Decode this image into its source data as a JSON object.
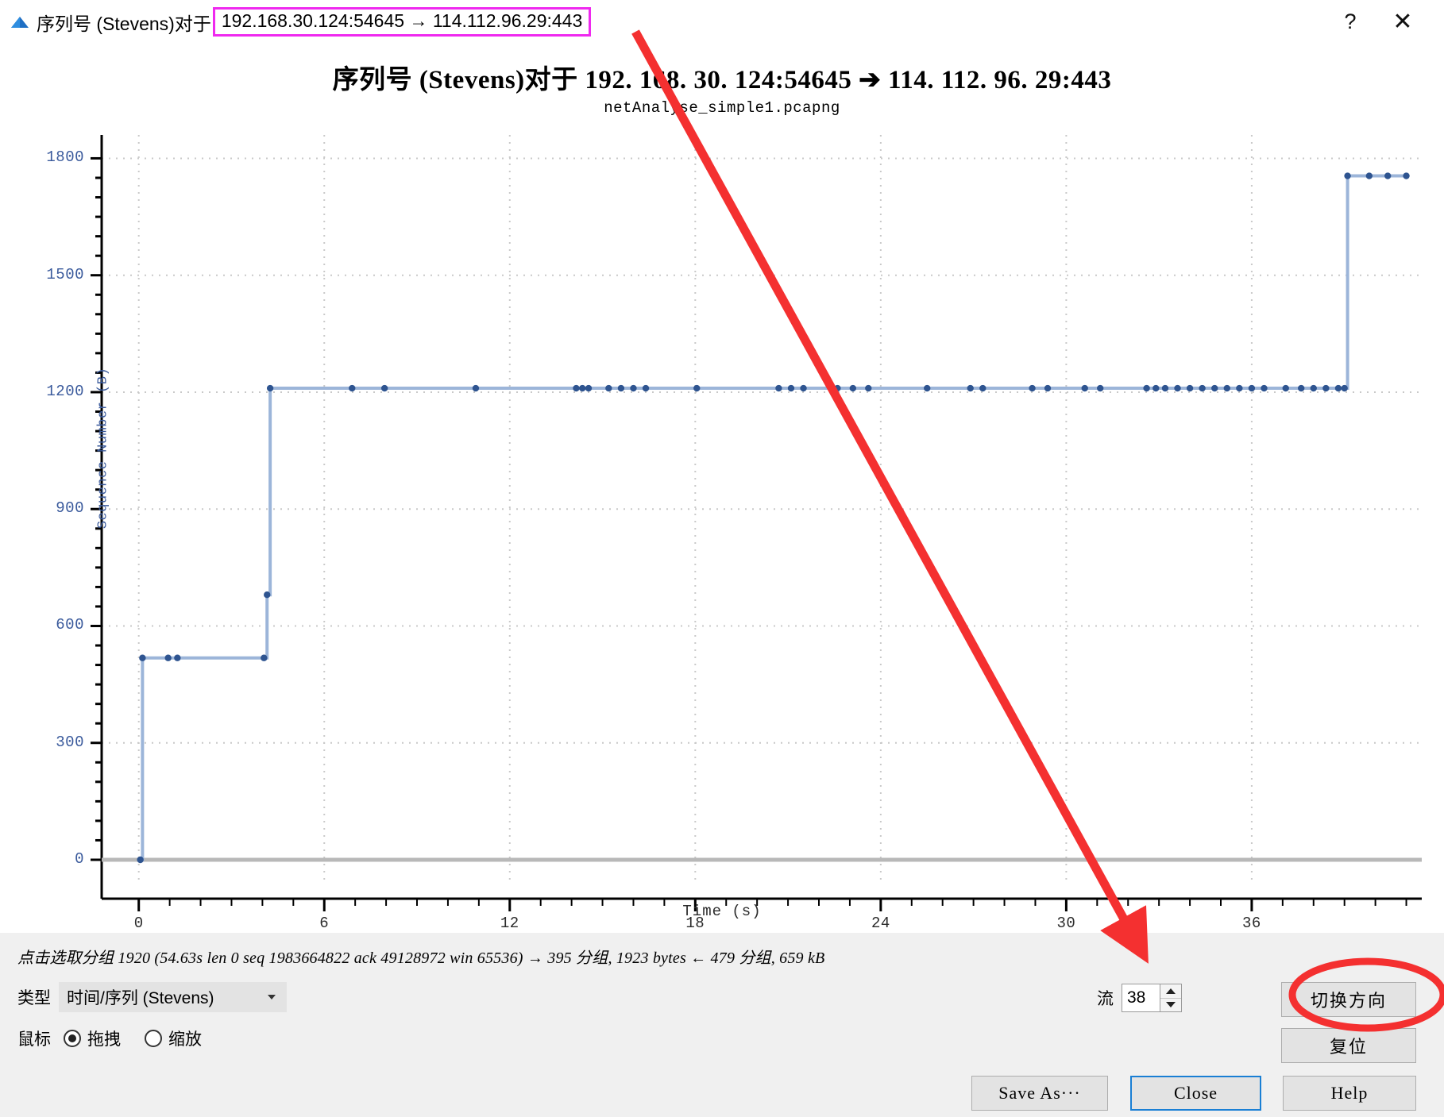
{
  "window": {
    "logo_icon": "wireshark-logo-icon",
    "title_prefix": "序列号 (Stevens)对于",
    "title_endpoints": "192.168.30.124:54645 → 114.112.96.29:443",
    "help_icon": "?",
    "close_icon": "✕",
    "highlight_color": "#ef29ef"
  },
  "chart_data": {
    "type": "line",
    "title": "序列号 (Stevens)对于 192. 168. 30. 124:54645  ➔  114. 112. 96. 29:443",
    "subtitle": "netAnalyse_simple1.pcapng",
    "xlabel": "Time (s)",
    "ylabel": "Sequence Number (B)",
    "xlim": [
      -1.2,
      41.5
    ],
    "ylim": [
      -55,
      1860
    ],
    "xticks": [
      0,
      6,
      12,
      18,
      24,
      30,
      36
    ],
    "yticks": [
      0,
      300,
      600,
      900,
      1200,
      1500,
      1800
    ],
    "grid": true,
    "legend": "none",
    "series": [
      {
        "name": "Sequence Number",
        "color": "#3a5f9e",
        "style": "step-post-with-markers",
        "points": [
          [
            0.05,
            0
          ],
          [
            0.12,
            518
          ],
          [
            0.95,
            518
          ],
          [
            1.25,
            518
          ],
          [
            4.05,
            518
          ],
          [
            4.15,
            680
          ],
          [
            4.25,
            1210
          ],
          [
            6.9,
            1210
          ],
          [
            7.95,
            1210
          ],
          [
            10.9,
            1210
          ],
          [
            14.15,
            1210
          ],
          [
            14.35,
            1210
          ],
          [
            14.55,
            1210
          ],
          [
            15.2,
            1210
          ],
          [
            15.6,
            1210
          ],
          [
            16.0,
            1210
          ],
          [
            16.4,
            1210
          ],
          [
            18.05,
            1210
          ],
          [
            20.7,
            1210
          ],
          [
            21.1,
            1210
          ],
          [
            21.5,
            1210
          ],
          [
            22.6,
            1210
          ],
          [
            23.1,
            1210
          ],
          [
            23.6,
            1210
          ],
          [
            25.5,
            1210
          ],
          [
            26.9,
            1210
          ],
          [
            27.3,
            1210
          ],
          [
            28.9,
            1210
          ],
          [
            29.4,
            1210
          ],
          [
            30.6,
            1210
          ],
          [
            31.1,
            1210
          ],
          [
            32.6,
            1210
          ],
          [
            32.9,
            1210
          ],
          [
            33.2,
            1210
          ],
          [
            33.6,
            1210
          ],
          [
            34.0,
            1210
          ],
          [
            34.4,
            1210
          ],
          [
            34.8,
            1210
          ],
          [
            35.2,
            1210
          ],
          [
            35.6,
            1210
          ],
          [
            36.0,
            1210
          ],
          [
            36.4,
            1210
          ],
          [
            37.1,
            1210
          ],
          [
            37.6,
            1210
          ],
          [
            38.0,
            1210
          ],
          [
            38.4,
            1210
          ],
          [
            38.8,
            1210
          ],
          [
            39.0,
            1210
          ],
          [
            39.1,
            1755
          ],
          [
            39.8,
            1755
          ],
          [
            40.4,
            1755
          ],
          [
            41.0,
            1755
          ]
        ]
      }
    ]
  },
  "status": {
    "text": "点击选取分组 1920 (54.63s len 0 seq 1983664822 ack 49128972 win 65536) → 395 分组, 1923 bytes ← 479 分组, 659 kB"
  },
  "controls": {
    "type_label": "类型",
    "type_value": "时间/序列 (Stevens)",
    "mouse_label": "鼠标",
    "mouse_drag_label": "拖拽",
    "mouse_zoom_label": "缩放",
    "mouse_selected": "拖拽",
    "flow_label": "流",
    "flow_value": "38",
    "switch_direction_label": "切换方向",
    "reset_label": "复位",
    "save_as_label": "Save As···",
    "close_label": "Close",
    "help_label": "Help",
    "focus_color": "#1a7fd4"
  },
  "annotations": {
    "arrow_color": "#f43030",
    "ellipse_color": "#f43030",
    "title_box_color": "#ef29ef"
  }
}
